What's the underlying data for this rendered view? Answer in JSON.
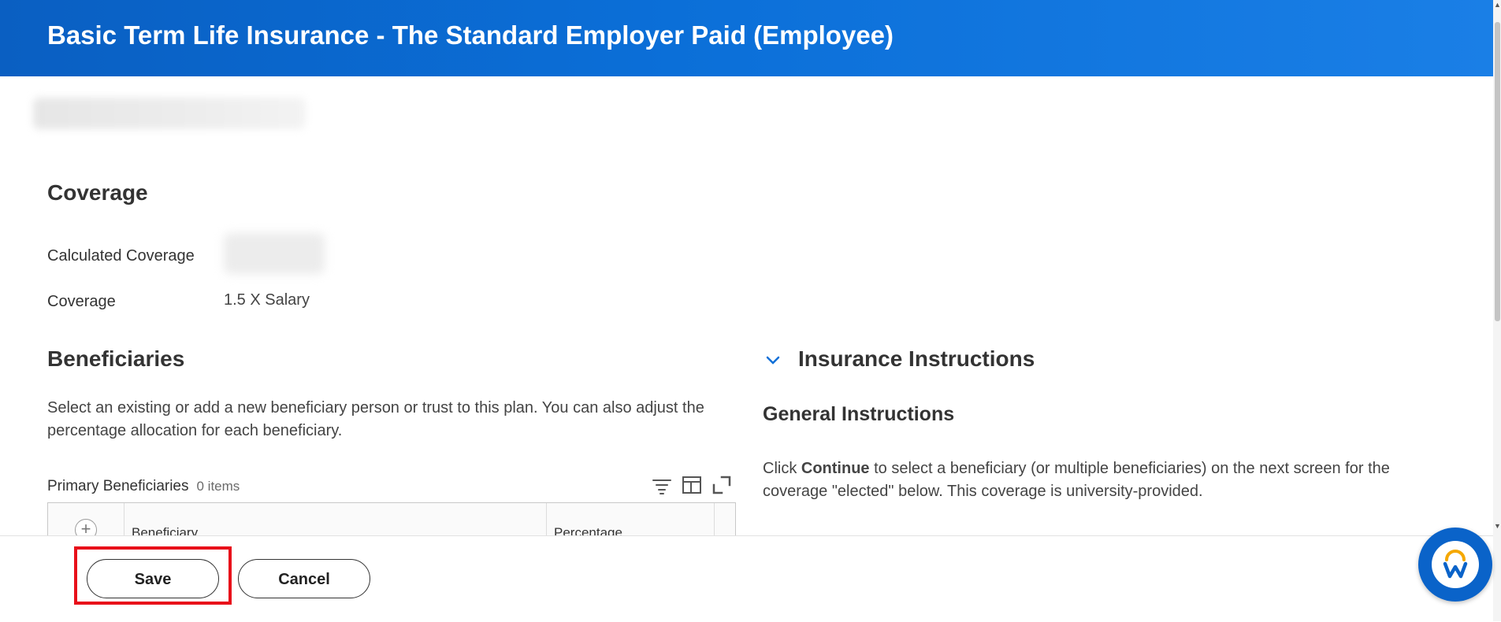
{
  "header": {
    "title": "Basic Term Life Insurance - The Standard Employer Paid (Employee)"
  },
  "coverage": {
    "title": "Coverage",
    "calculated_label": "Calculated Coverage",
    "coverage_label": "Coverage",
    "coverage_value": "1.5 X Salary"
  },
  "beneficiaries": {
    "title": "Beneficiaries",
    "description": "Select an existing or add a new beneficiary person or trust to this plan. You can also adjust the percentage allocation for each beneficiary.",
    "grid": {
      "title": "Primary Beneficiaries",
      "count": "0 items",
      "columns": [
        "Beneficiary",
        "Percentage"
      ]
    }
  },
  "instructions": {
    "title": "Insurance Instructions",
    "general_title": "General Instructions",
    "text_before": "Click ",
    "text_bold": "Continue",
    "text_after": " to select a beneficiary (or multiple beneficiaries) on the next screen for the coverage \"elected\" below. This coverage is university-provided."
  },
  "footer": {
    "save_label": "Save",
    "cancel_label": "Cancel"
  },
  "colors": {
    "header_blue": "#0b6fd8",
    "highlight_red": "#e8101a",
    "assistant_blue": "#0a63c9"
  },
  "icons": [
    "filter-icon",
    "columns-icon",
    "fullscreen-icon",
    "add-icon",
    "chevron-down-icon",
    "workday-assistant-icon"
  ]
}
